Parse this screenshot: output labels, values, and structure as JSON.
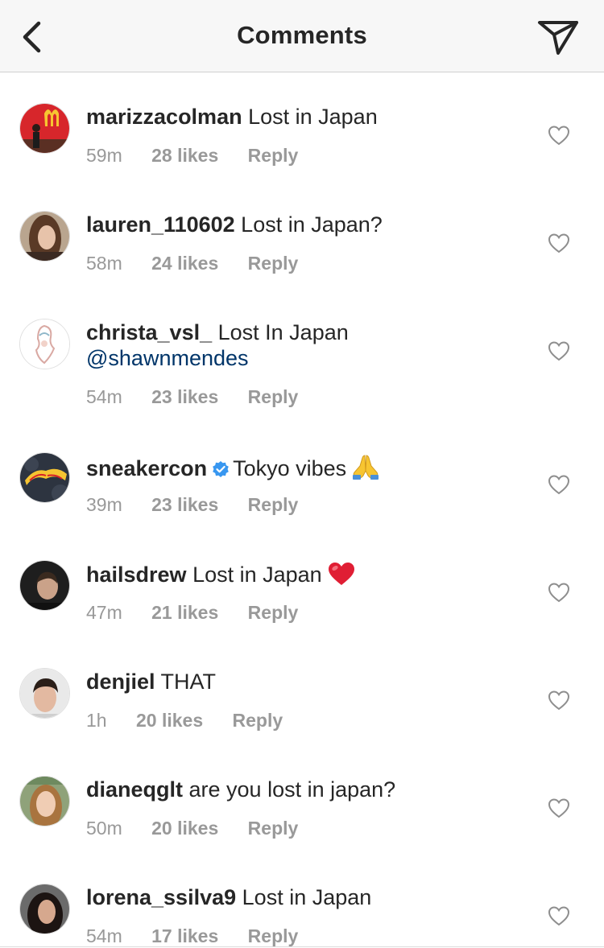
{
  "header": {
    "title": "Comments",
    "back_icon": "chevron-left-icon",
    "share_icon": "paper-plane-icon"
  },
  "colors": {
    "header_bg": "#f7f7f7",
    "text": "#262626",
    "meta": "#999999",
    "mention": "#003569",
    "verified": "#3897f0",
    "heart_emoji": "#e0245e"
  },
  "comments": [
    {
      "username": "marizzacolman",
      "text": "Lost in Japan",
      "time": "59m",
      "likes": "28 likes",
      "reply": "Reply"
    },
    {
      "username": "lauren_110602",
      "text": "Lost in Japan?",
      "time": "58m",
      "likes": "24 likes",
      "reply": "Reply"
    },
    {
      "username": "christa_vsl_",
      "text": "Lost In Japan",
      "mention": "@shawnmendes",
      "time": "54m",
      "likes": "23 likes",
      "reply": "Reply"
    },
    {
      "username": "sneakercon",
      "verified": true,
      "text": "Tokyo vibes",
      "emoji": "folded-hands-emoji",
      "time": "39m",
      "likes": "23 likes",
      "reply": "Reply"
    },
    {
      "username": "hailsdrew",
      "text": "Lost in Japan",
      "emoji": "red-heart-emoji",
      "time": "47m",
      "likes": "21 likes",
      "reply": "Reply"
    },
    {
      "username": "denjiel",
      "text": "THAT",
      "time": "1h",
      "likes": "20 likes",
      "reply": "Reply"
    },
    {
      "username": "dianeqglt",
      "text": "are you lost in japan?",
      "time": "50m",
      "likes": "20 likes",
      "reply": "Reply"
    },
    {
      "username": "lorena_ssilva9",
      "text": "Lost in Japan",
      "time": "54m",
      "likes": "17 likes",
      "reply": "Reply"
    }
  ]
}
